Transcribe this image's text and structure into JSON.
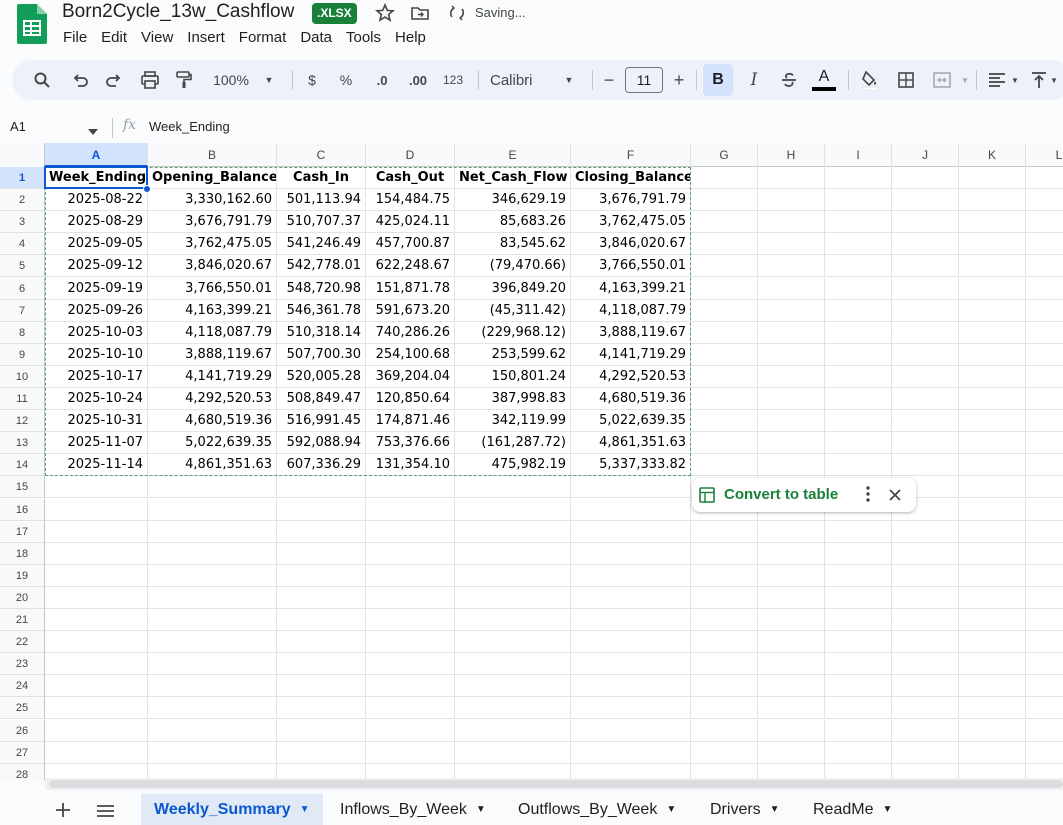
{
  "app": {
    "doc_title": "Born2Cycle_13w_Cashflow",
    "format_badge": ".XLSX",
    "save_status": "Saving...",
    "menu": [
      "File",
      "Edit",
      "View",
      "Insert",
      "Format",
      "Data",
      "Tools",
      "Help"
    ]
  },
  "toolbar": {
    "zoom": "100%",
    "currency": "$",
    "percent": "%",
    "decrease_decimals": ".0",
    "increase_decimals": ".00",
    "number_formats": "123",
    "font": "Calibri",
    "font_size": "11",
    "bold": "B",
    "italic": "I",
    "text_color": "A",
    "icons": [
      "search-icon",
      "undo-icon",
      "redo-icon",
      "print-icon",
      "paint-format-icon",
      "strikethrough-icon",
      "fill-color-icon",
      "borders-icon",
      "merge-cells-icon",
      "align-left-icon",
      "valign-top-icon"
    ]
  },
  "formula_bar": {
    "cell_ref": "A1",
    "fx": "fx",
    "content": "Week_Ending"
  },
  "grid": {
    "columns": [
      "A",
      "B",
      "C",
      "D",
      "E",
      "F",
      "G",
      "H",
      "I",
      "J",
      "K",
      "L"
    ],
    "rows": [
      "1",
      "2",
      "3",
      "4",
      "5",
      "6",
      "7",
      "8",
      "9",
      "10",
      "11",
      "12",
      "13",
      "14",
      "15",
      "16",
      "17",
      "18",
      "19",
      "20",
      "21",
      "22",
      "23",
      "24",
      "25",
      "26",
      "27",
      "28"
    ],
    "headers": [
      "Week_Ending",
      "Opening_Balance",
      "Cash_In",
      "Cash_Out",
      "Net_Cash_Flow",
      "Closing_Balance"
    ],
    "data": [
      [
        "2025-08-22",
        "3,330,162.60",
        "501,113.94",
        "154,484.75",
        "346,629.19",
        "3,676,791.79"
      ],
      [
        "2025-08-29",
        "3,676,791.79",
        "510,707.37",
        "425,024.11",
        "85,683.26",
        "3,762,475.05"
      ],
      [
        "2025-09-05",
        "3,762,475.05",
        "541,246.49",
        "457,700.87",
        "83,545.62",
        "3,846,020.67"
      ],
      [
        "2025-09-12",
        "3,846,020.67",
        "542,778.01",
        "622,248.67",
        "(79,470.66)",
        "3,766,550.01"
      ],
      [
        "2025-09-19",
        "3,766,550.01",
        "548,720.98",
        "151,871.78",
        "396,849.20",
        "4,163,399.21"
      ],
      [
        "2025-09-26",
        "4,163,399.21",
        "546,361.78",
        "591,673.20",
        "(45,311.42)",
        "4,118,087.79"
      ],
      [
        "2025-10-03",
        "4,118,087.79",
        "510,318.14",
        "740,286.26",
        "(229,968.12)",
        "3,888,119.67"
      ],
      [
        "2025-10-10",
        "3,888,119.67",
        "507,700.30",
        "254,100.68",
        "253,599.62",
        "4,141,719.29"
      ],
      [
        "2025-10-17",
        "4,141,719.29",
        "520,005.28",
        "369,204.04",
        "150,801.24",
        "4,292,520.53"
      ],
      [
        "2025-10-24",
        "4,292,520.53",
        "508,849.47",
        "120,850.64",
        "387,998.83",
        "4,680,519.36"
      ],
      [
        "2025-10-31",
        "4,680,519.36",
        "516,991.45",
        "174,871.46",
        "342,119.99",
        "5,022,639.35"
      ],
      [
        "2025-11-07",
        "5,022,639.35",
        "592,088.94",
        "753,376.66",
        "(161,287.72)",
        "4,861,351.63"
      ],
      [
        "2025-11-14",
        "4,861,351.63",
        "607,336.29",
        "131,354.10",
        "475,982.19",
        "5,337,333.82"
      ]
    ]
  },
  "convert_chip": {
    "label": "Convert to table"
  },
  "sheets": {
    "active": "Weekly_Summary",
    "tabs": [
      "Weekly_Summary",
      "Inflows_By_Week",
      "Outflows_By_Week",
      "Drivers",
      "ReadMe"
    ]
  },
  "colors": {
    "accent": "#0b57d0",
    "sheets_green": "#188038",
    "toolbar_bg": "#edf2fa"
  }
}
